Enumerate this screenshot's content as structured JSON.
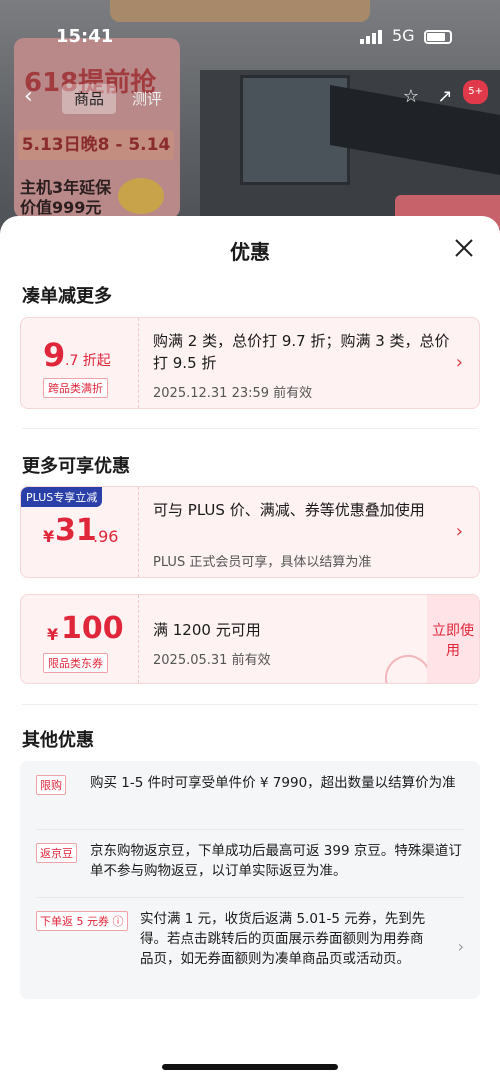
{
  "status_bar": {
    "time": "15:41",
    "network": "5G"
  },
  "background": {
    "nav_tabs": [
      "商品",
      "测评"
    ],
    "nav_badge": "5+",
    "ad": {
      "title": "618提前抢",
      "date": "5.13日晚8 - 5.14",
      "text": "主机3年延保 价值999元"
    }
  },
  "sheet": {
    "title": "优惠",
    "section1": {
      "title": "凑单减更多",
      "coupon": {
        "big": "9",
        "small": ".7 折起",
        "tag": "跨品类满折",
        "description": "购满 2 类，总价打 9.7 折；购满 3 类，总价打 9.5 折",
        "date": "2025.12.31 23:59 前有效"
      }
    },
    "section2": {
      "title": "更多可享优惠",
      "plus_coupon": {
        "tag": "PLUS专享立减",
        "currency": "¥",
        "amount": "31",
        "decimal": ".96",
        "description": "可与 PLUS 价、满减、券等优惠叠加使用",
        "note": "PLUS 正式会员可享，具体以结算为准"
      },
      "jd_coupon": {
        "currency": "¥",
        "amount": "100",
        "tag": "限品类东券",
        "condition": "满 1200 元可用",
        "date": "2025.05.31 前有效",
        "use_button": "立即使用"
      }
    },
    "section3": {
      "title": "其他优惠",
      "items": [
        {
          "tag": "限购",
          "text": "购买 1-5 件时可享受单件价 ¥ 7990，超出数量以结算价为准"
        },
        {
          "tag": "返京豆",
          "text": "京东购物返京豆，下单成功后最高可返 399 京豆。特殊渠道订单不参与购物返豆，以订单实际返豆为准。"
        },
        {
          "tag": "下单返 5 元券 ⓘ",
          "text": "实付满 1 元，收货后返满 5.01-5 元券，先到先得。若点击跳转后的页面展示券面额则为用券商品页，如无券面额则为凑单商品页或活动页。"
        }
      ]
    }
  },
  "colors": {
    "accent": "#e0263a",
    "plus_blue": "#2a3fa8",
    "coupon_bg": "#fff2f2"
  }
}
